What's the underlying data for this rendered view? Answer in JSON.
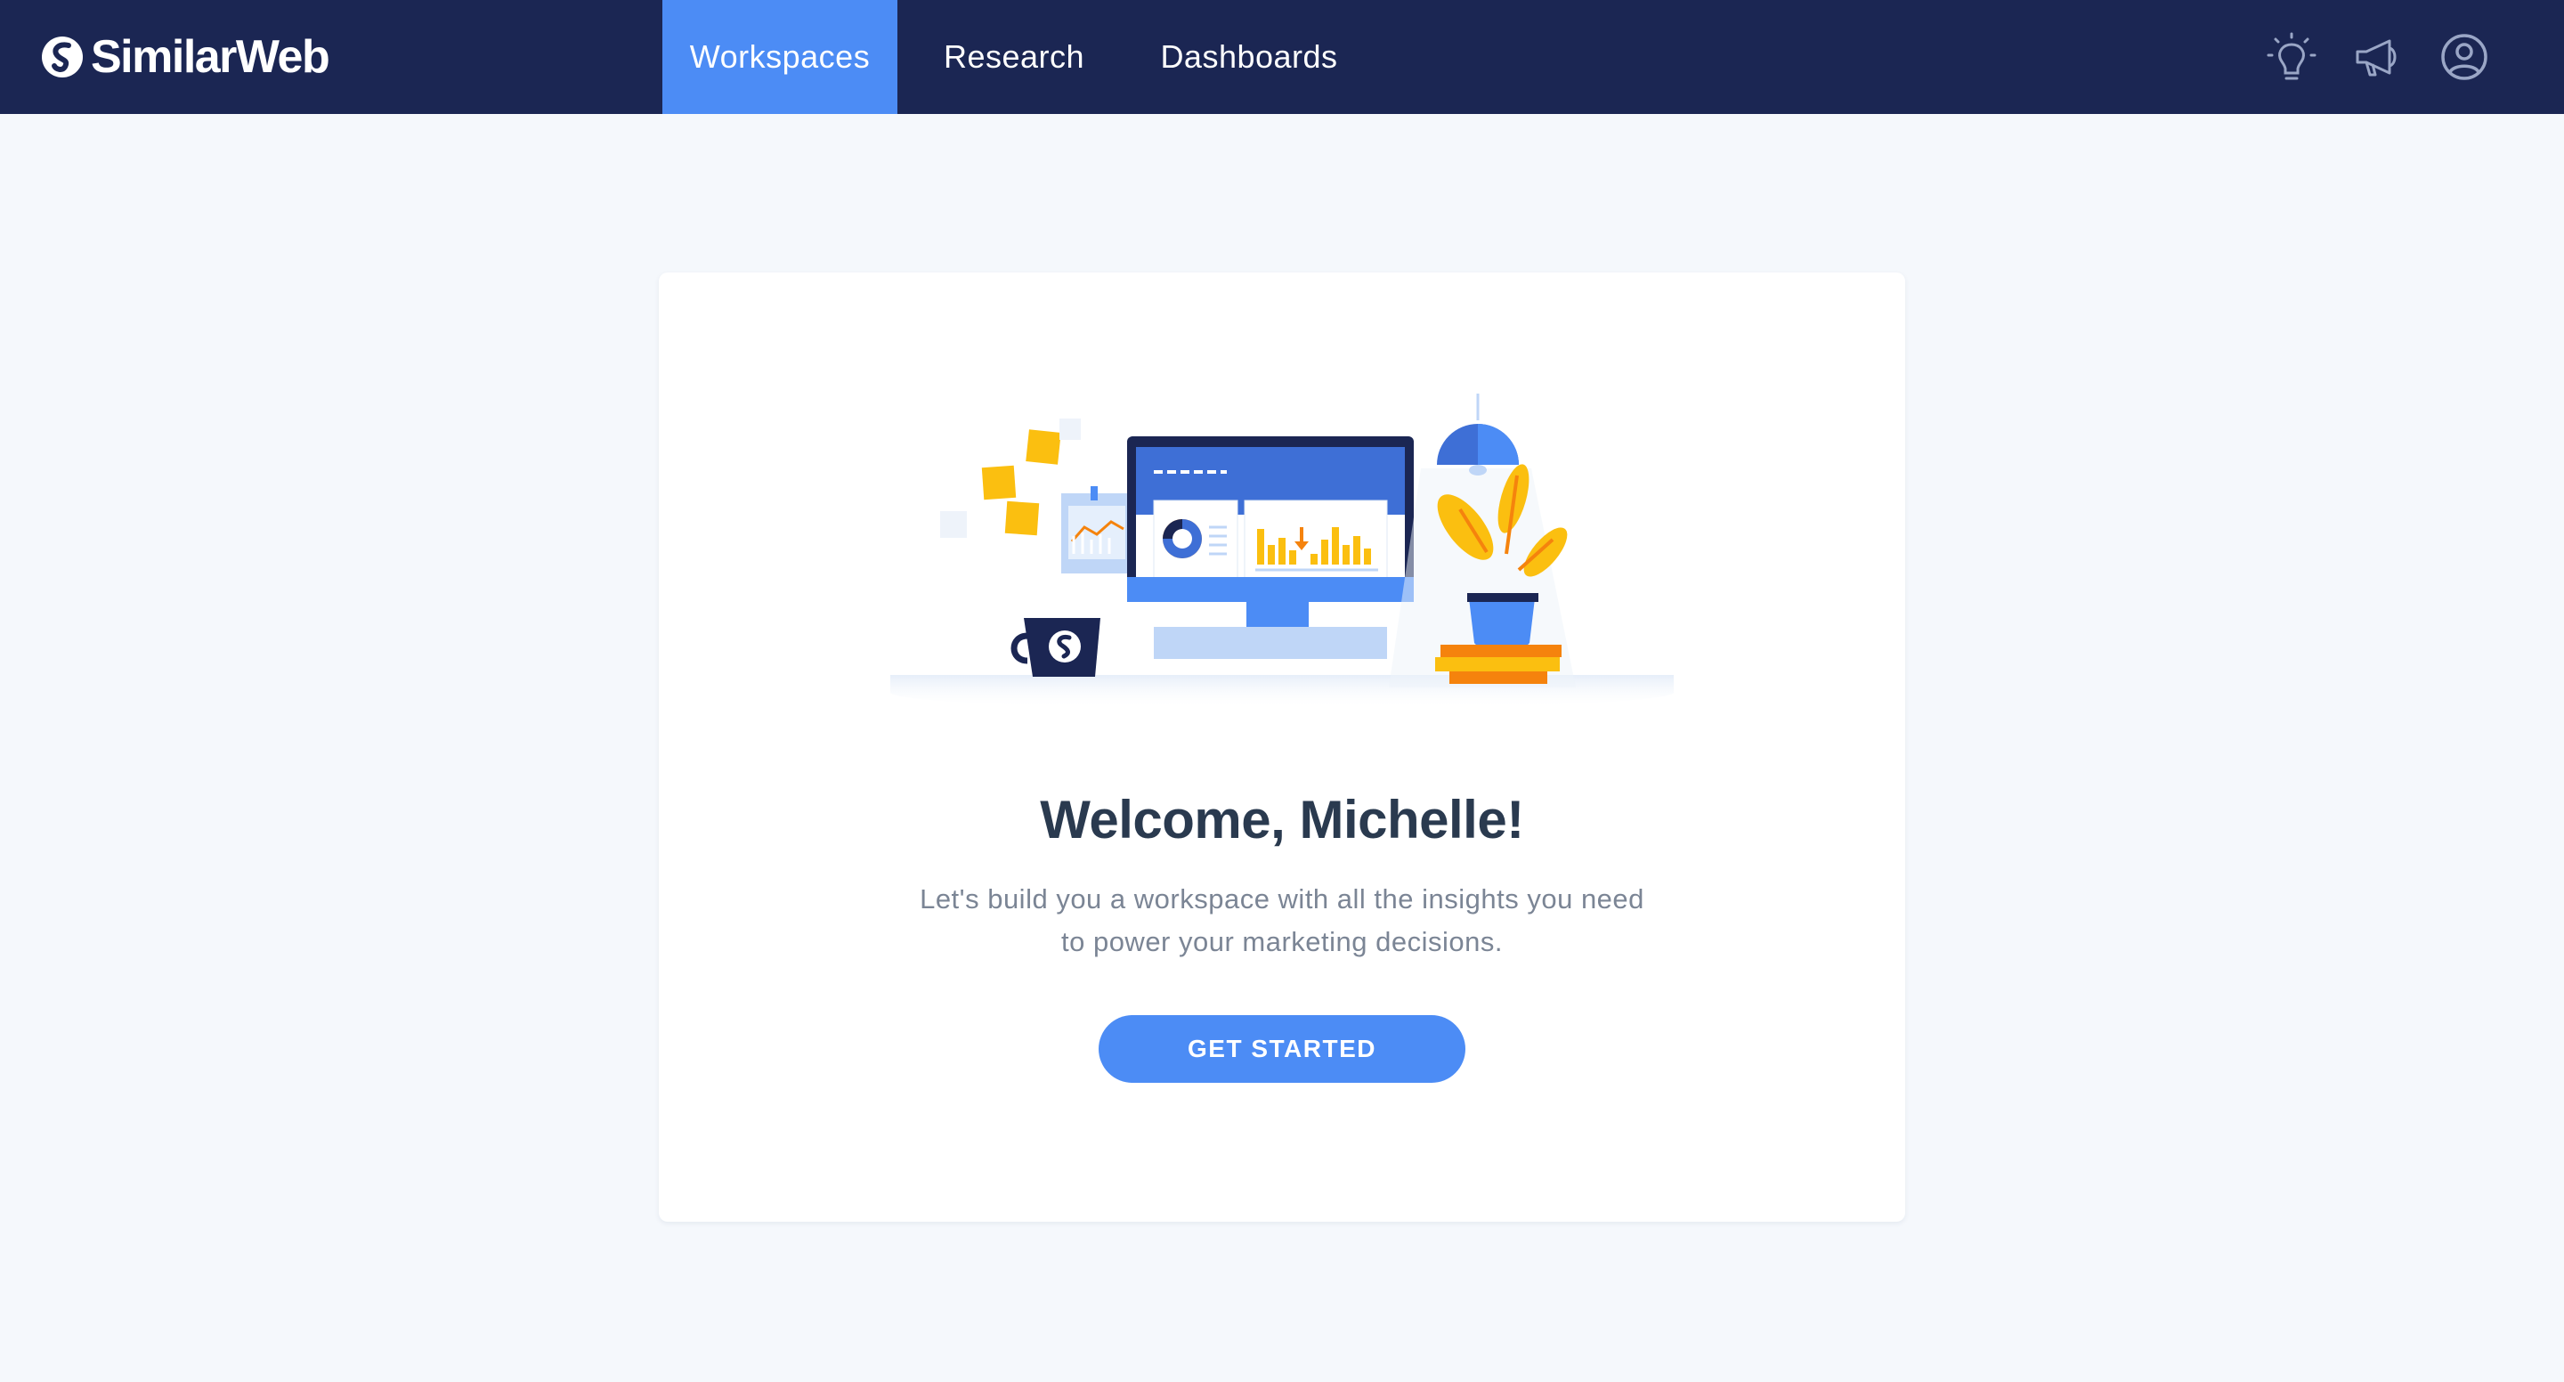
{
  "header": {
    "brand": "SimilarWeb",
    "tabs": [
      {
        "label": "Workspaces",
        "active": true
      },
      {
        "label": "Research",
        "active": false
      },
      {
        "label": "Dashboards",
        "active": false
      }
    ],
    "icons": [
      "lightbulb-icon",
      "megaphone-icon",
      "user-account-icon"
    ]
  },
  "welcome": {
    "title": "Welcome, Michelle!",
    "subtitle_line1": "Let's build you a workspace with all the insights you need",
    "subtitle_line2": "to power your marketing decisions.",
    "cta_label": "GET STARTED"
  },
  "colors": {
    "nav_bg": "#1b2653",
    "accent": "#4c8cf5",
    "page_bg": "#f5f8fc",
    "heading": "#2a3a4f",
    "body_text": "#7b8595",
    "yellow": "#fbbf10",
    "orange": "#f5830d"
  }
}
